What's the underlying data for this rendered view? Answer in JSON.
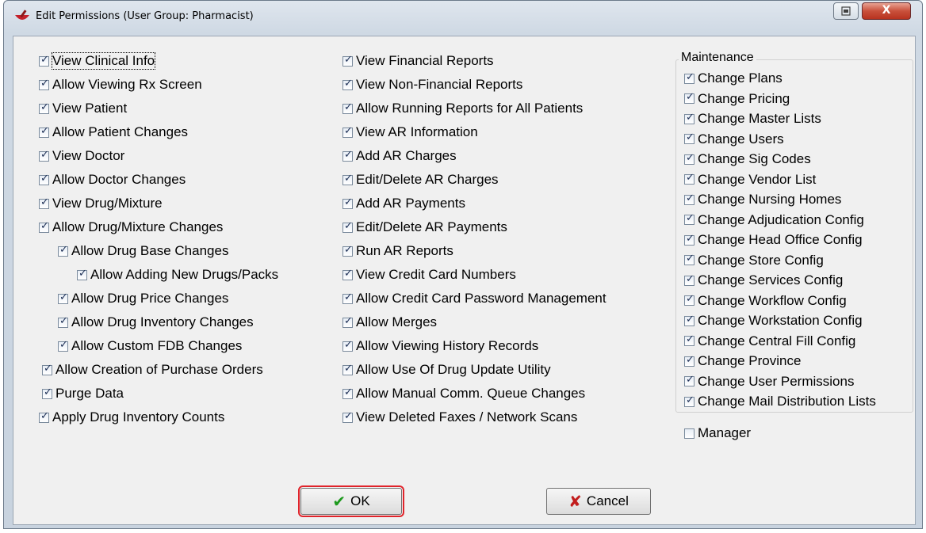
{
  "window": {
    "title": "Edit Permissions (User Group: Pharmacist)",
    "close_label": "X"
  },
  "col1": [
    {
      "label": "View Clinical Info",
      "checked": true
    },
    {
      "label": "Allow Viewing Rx Screen",
      "checked": true
    },
    {
      "label": "View Patient",
      "checked": true
    },
    {
      "label": "Allow Patient Changes",
      "checked": true
    },
    {
      "label": "View Doctor",
      "checked": true
    },
    {
      "label": "Allow Doctor Changes",
      "checked": true
    },
    {
      "label": "View Drug/Mixture",
      "checked": true
    },
    {
      "label": "Allow Drug/Mixture Changes",
      "checked": true
    },
    {
      "label": "Allow Drug Base Changes",
      "checked": true
    },
    {
      "label": "Allow Adding New Drugs/Packs",
      "checked": true
    },
    {
      "label": "Allow Drug Price Changes",
      "checked": true
    },
    {
      "label": "Allow Drug Inventory Changes",
      "checked": true
    },
    {
      "label": "Allow Custom FDB Changes",
      "checked": true
    },
    {
      "label": "Allow Creation of Purchase Orders",
      "checked": true
    },
    {
      "label": "Purge Data",
      "checked": true
    },
    {
      "label": "Apply Drug Inventory Counts",
      "checked": true
    }
  ],
  "col2": [
    {
      "label": "View Financial Reports",
      "checked": true
    },
    {
      "label": "View Non-Financial Reports",
      "checked": true
    },
    {
      "label": "Allow Running Reports for All Patients",
      "checked": true
    },
    {
      "label": "View AR Information",
      "checked": true
    },
    {
      "label": "Add AR Charges",
      "checked": true
    },
    {
      "label": "Edit/Delete AR Charges",
      "checked": true
    },
    {
      "label": "Add AR Payments",
      "checked": true
    },
    {
      "label": "Edit/Delete AR Payments",
      "checked": true
    },
    {
      "label": "Run AR Reports",
      "checked": true
    },
    {
      "label": "View Credit Card Numbers",
      "checked": true
    },
    {
      "label": "Allow Credit Card Password Management",
      "checked": true
    },
    {
      "label": "Allow Merges",
      "checked": true
    },
    {
      "label": "Allow Viewing History Records",
      "checked": true
    },
    {
      "label": "Allow Use Of Drug Update Utility",
      "checked": true
    },
    {
      "label": "Allow Manual Comm. Queue Changes",
      "checked": true
    },
    {
      "label": "View Deleted Faxes / Network Scans",
      "checked": true
    }
  ],
  "maintenance": {
    "title": "Maintenance",
    "items": [
      {
        "label": "Change Plans",
        "checked": true
      },
      {
        "label": "Change Pricing",
        "checked": true
      },
      {
        "label": "Change Master Lists",
        "checked": true
      },
      {
        "label": "Change Users",
        "checked": true
      },
      {
        "label": "Change Sig Codes",
        "checked": true
      },
      {
        "label": "Change Vendor List",
        "checked": true
      },
      {
        "label": "Change Nursing Homes",
        "checked": true
      },
      {
        "label": "Change Adjudication Config",
        "checked": true
      },
      {
        "label": "Change Head Office Config",
        "checked": true
      },
      {
        "label": "Change Store Config",
        "checked": true
      },
      {
        "label": "Change Services Config",
        "checked": true
      },
      {
        "label": "Change Workflow Config",
        "checked": true
      },
      {
        "label": "Change Workstation Config",
        "checked": true
      },
      {
        "label": "Change Central Fill Config",
        "checked": true
      },
      {
        "label": "Change Province",
        "checked": true
      },
      {
        "label": "Change User Permissions",
        "checked": true
      },
      {
        "label": "Change Mail Distribution Lists",
        "checked": true
      }
    ]
  },
  "manager": {
    "label": "Manager",
    "checked": false
  },
  "buttons": {
    "ok_label": "OK",
    "cancel_label": "Cancel"
  },
  "colors": {
    "ok_highlight": "#e0242b",
    "ok_check": "#1e9a1e",
    "cancel_x": "#c21d1d"
  },
  "icons": {
    "title_icon": "mortar-pestle-icon",
    "ok_icon": "checkmark-icon",
    "cancel_icon": "x-icon"
  }
}
